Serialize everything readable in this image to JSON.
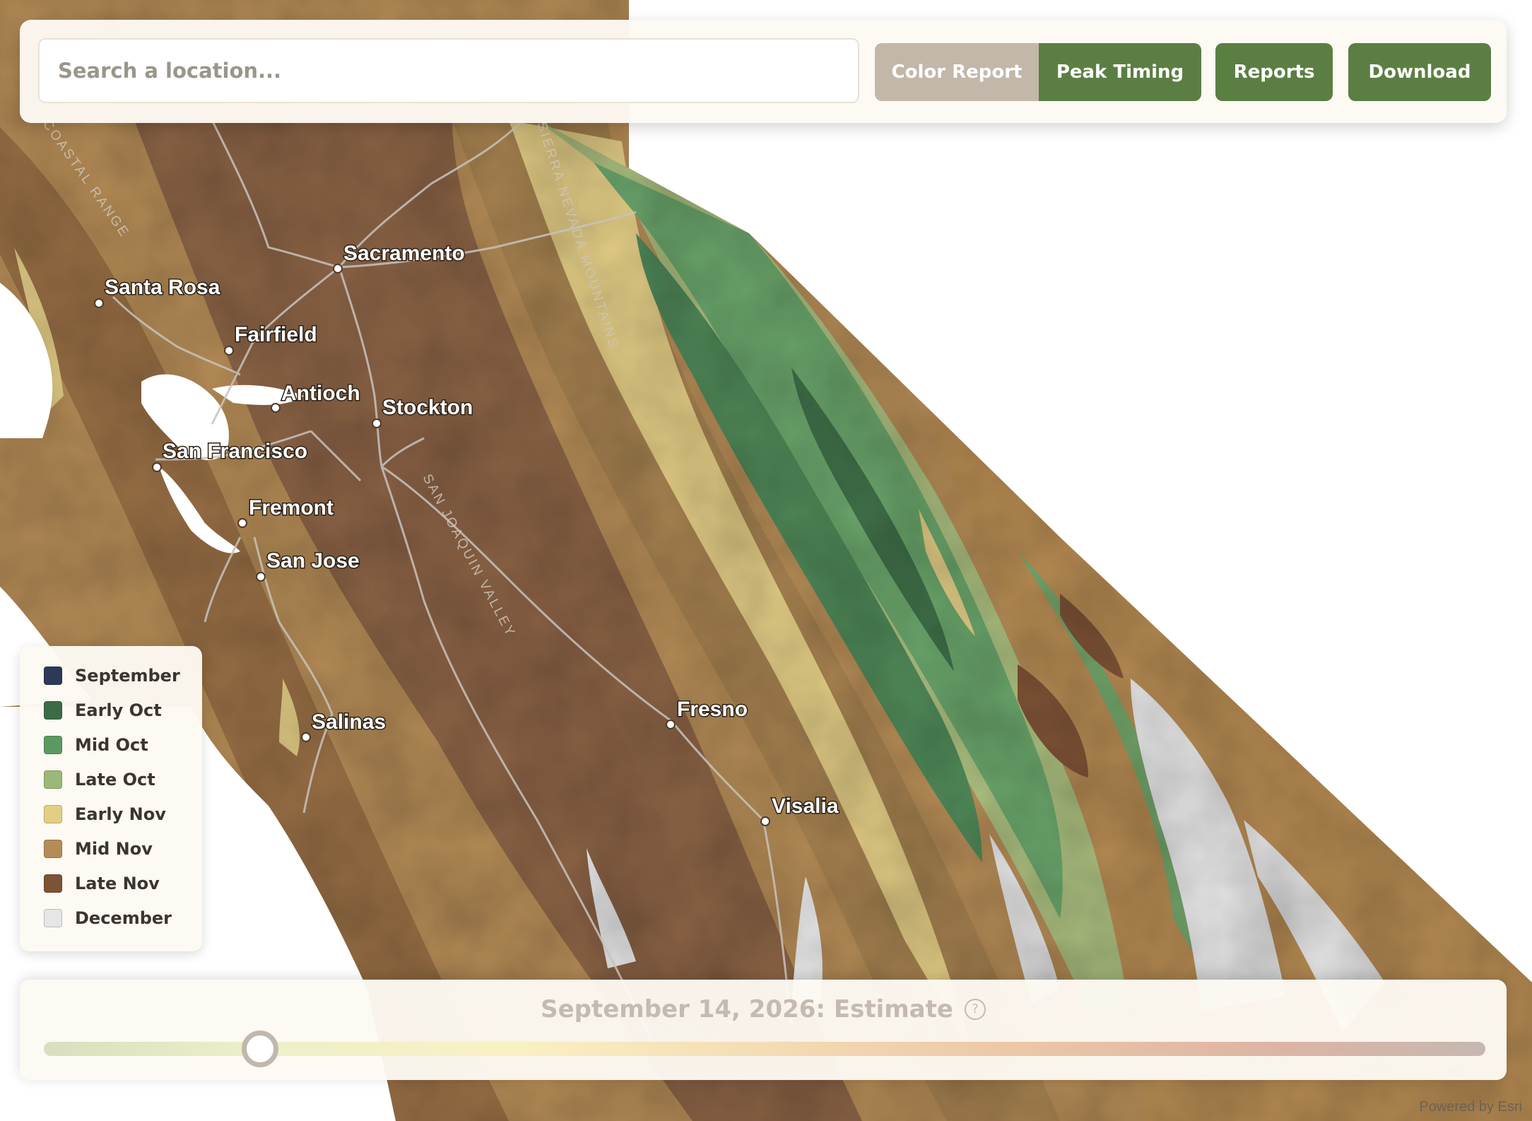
{
  "search": {
    "placeholder": "Search a location..."
  },
  "toolbar": {
    "color_report_label": "Color Report",
    "peak_timing_label": "Peak Timing",
    "reports_label": "Reports",
    "download_label": "Download"
  },
  "map": {
    "cities": [
      {
        "name": "Sacramento"
      },
      {
        "name": "Santa Rosa"
      },
      {
        "name": "Fairfield"
      },
      {
        "name": "Antioch"
      },
      {
        "name": "Stockton"
      },
      {
        "name": "San Francisco"
      },
      {
        "name": "Fremont"
      },
      {
        "name": "San Jose"
      },
      {
        "name": "Salinas"
      },
      {
        "name": "Fresno"
      },
      {
        "name": "Visalia"
      }
    ],
    "regions": [
      {
        "name": "SIERRA NEVADA MOUNTAINS"
      },
      {
        "name": "SAN JOAQUIN VALLEY"
      },
      {
        "name": "COASTAL RANGE"
      }
    ]
  },
  "legend": {
    "items": [
      {
        "label": "September",
        "color": "#2c3a57"
      },
      {
        "label": "Early Oct",
        "color": "#3d6b45"
      },
      {
        "label": "Mid Oct",
        "color": "#5a9a62"
      },
      {
        "label": "Late Oct",
        "color": "#9ab978"
      },
      {
        "label": "Early Nov",
        "color": "#e3cf82"
      },
      {
        "label": "Mid Nov",
        "color": "#b58c56"
      },
      {
        "label": "Late Nov",
        "color": "#7d5236"
      },
      {
        "label": "December",
        "color": "#e6e6e6"
      }
    ]
  },
  "timeline": {
    "title": "September 14, 2026: Estimate",
    "help_icon": "question-circle-icon",
    "position": 0.15
  },
  "attribution": "Powered by Esri"
}
